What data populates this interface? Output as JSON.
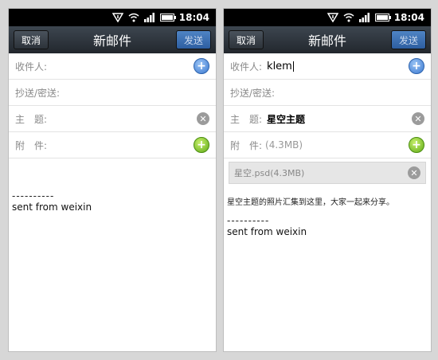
{
  "status": {
    "time": "18:04"
  },
  "left": {
    "cancel": "取消",
    "title": "新邮件",
    "send": "发送",
    "to_label": "收件人:",
    "cc_label": "抄送/密送:",
    "subject_label": "主　题:",
    "attach_label": "附　件:",
    "sig_line": "----------",
    "sig_text": "sent from weixin"
  },
  "right": {
    "cancel": "取消",
    "title": "新邮件",
    "send": "发送",
    "to_label": "收件人:",
    "to_value": "klem",
    "cc_label": "抄送/密送:",
    "subject_label": "主　题:",
    "subject_value": "星空主题",
    "attach_label": "附　件:",
    "attach_size": "(4.3MB)",
    "attachment_name": "星空.psd(4.3MB)",
    "body_text": "星空主题的照片汇集到这里，大家一起来分享。",
    "sig_line": "----------",
    "sig_text": "sent from weixin"
  },
  "icons": {
    "add_recipient": "plus-circle-blue",
    "add_attachment": "plus-circle-green",
    "clear": "x-circle-gray"
  },
  "colors": {
    "titlebar": "#2b3137",
    "send_button": "#3d6fb3",
    "background": "#d7d7d7"
  }
}
